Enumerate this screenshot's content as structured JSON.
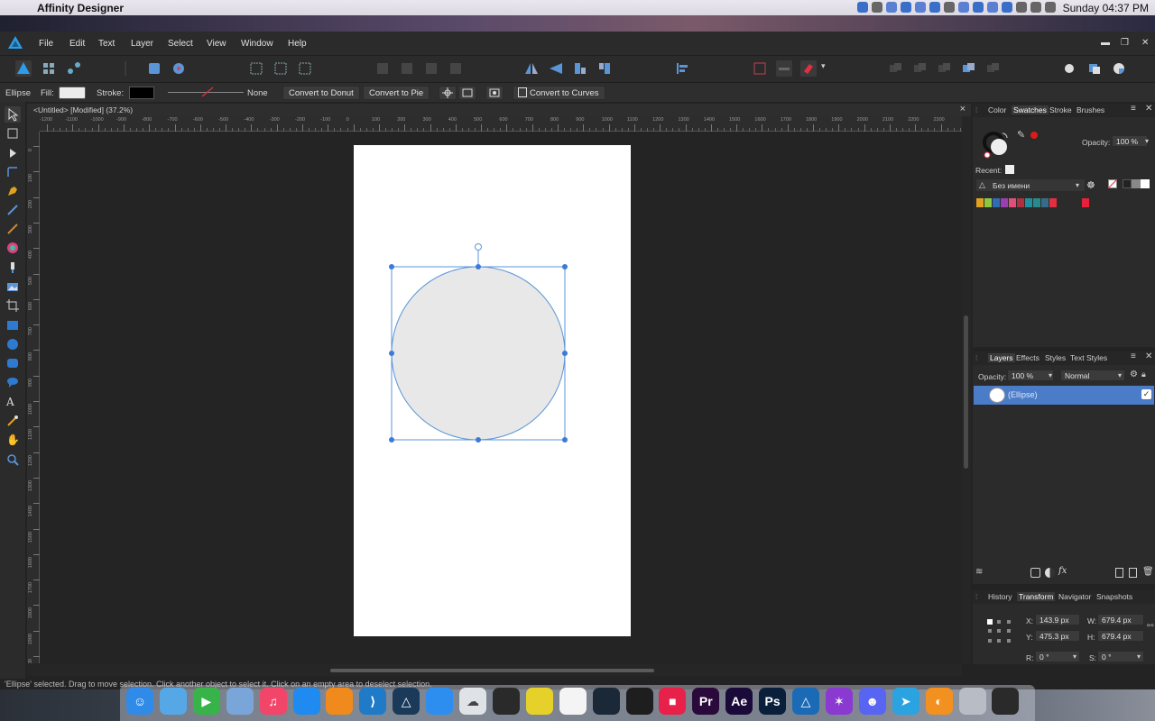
{
  "menubar": {
    "app_name": "Affinity Designer",
    "clock": "Sunday 04:37 PM"
  },
  "app_menu": [
    "File",
    "Edit",
    "Text",
    "Layer",
    "Select",
    "View",
    "Window",
    "Help"
  ],
  "context_bar": {
    "tool_name": "Ellipse",
    "fill_label": "Fill:",
    "stroke_label": "Stroke:",
    "stroke_none": "None",
    "convert_donut": "Convert to Donut",
    "convert_pie": "Convert to Pie",
    "convert_curves": "Convert to Curves"
  },
  "document": {
    "tab_title": "<Untitled> [Modified] (37.2%)",
    "close": "×"
  },
  "ruler_h_labels": [
    "-1200",
    "-1100",
    "-1000",
    "-900",
    "-800",
    "-700",
    "-600",
    "-500",
    "-400",
    "-300",
    "-200",
    "-100",
    "0",
    "100",
    "200",
    "300",
    "400",
    "500",
    "600",
    "700",
    "800",
    "900",
    "1000",
    "1100",
    "1200",
    "1300",
    "1400",
    "1500",
    "1600",
    "1700",
    "1800",
    "1900",
    "2000",
    "2100",
    "2200",
    "2300"
  ],
  "ruler_v_labels": [
    "0",
    "100",
    "200",
    "300",
    "400",
    "500",
    "600",
    "700",
    "800",
    "900",
    "1000",
    "1100",
    "1200",
    "1300",
    "1400",
    "1500",
    "1600",
    "1700",
    "1800",
    "1900",
    "2000"
  ],
  "status_text": "'Ellipse' selected. Drag to move selection. Click another object to select it. Click on an empty area to deselect selection.",
  "color_panel": {
    "tabs": [
      "Color",
      "Swatches",
      "Stroke",
      "Brushes"
    ],
    "active_tab": "Swatches",
    "opacity_label": "Opacity:",
    "opacity_value": "100 %",
    "recent_label": "Recent:",
    "palette_name": "Без имени",
    "swatch_colors": [
      "#e0a020",
      "#8dc63f",
      "#2f6db5",
      "#9a3fb0",
      "#e0507a",
      "#b03040",
      "#1e90a0",
      "#2a8a8a",
      "#3a6a8a",
      "#e03040",
      "#2b2b2b",
      "#2b2b2b",
      "#2b2b2b",
      "#e8203a"
    ]
  },
  "layers_panel": {
    "tabs": [
      "Layers",
      "Effects",
      "Styles",
      "Text Styles"
    ],
    "active_tab": "Layers",
    "opacity_label": "Opacity:",
    "opacity_value": "100 %",
    "blend_mode": "Normal",
    "layer_name": "(Ellipse)",
    "fx_label": "fx"
  },
  "transform_panel": {
    "tabs": [
      "History",
      "Transform",
      "Navigator",
      "Snapshots"
    ],
    "active_tab": "Transform",
    "x_label": "X:",
    "x_value": "143.9 px",
    "y_label": "Y:",
    "y_value": "475.3 px",
    "w_label": "W:",
    "w_value": "679.4 px",
    "h_label": "H:",
    "h_value": "679.4 px",
    "r_label": "R:",
    "r_value": "0 °",
    "s_label": "S:",
    "s_value": "0 °"
  },
  "dock": [
    {
      "name": "Finder",
      "color": "#2f8ae8",
      "glyph": "☺"
    },
    {
      "name": "Files",
      "color": "#56a7e6",
      "glyph": ""
    },
    {
      "name": "FaceTime",
      "color": "#38b34a",
      "glyph": "▶"
    },
    {
      "name": "Preview",
      "color": "#7aa5d8",
      "glyph": ""
    },
    {
      "name": "Music",
      "color": "#f2456a",
      "glyph": "♫"
    },
    {
      "name": "App Store",
      "color": "#1f8af0",
      "glyph": ""
    },
    {
      "name": "Editor",
      "color": "#f08a1c",
      "glyph": ""
    },
    {
      "name": "VS Code",
      "color": "#1f7ac8",
      "glyph": "⟩"
    },
    {
      "name": "Affinity Designer",
      "color": "#1b3a5a",
      "glyph": "△"
    },
    {
      "name": "Safari",
      "color": "#2d8ef0",
      "glyph": ""
    },
    {
      "name": "Cloud",
      "color": "#dfe3e8",
      "glyph": "☁"
    },
    {
      "name": "DaVinci Resolve",
      "color": "#2a2a2a",
      "glyph": ""
    },
    {
      "name": "Nodes",
      "color": "#e6d12a",
      "glyph": ""
    },
    {
      "name": "Photos",
      "color": "#f4f4f4",
      "glyph": ""
    },
    {
      "name": "Steam",
      "color": "#1b2838",
      "glyph": ""
    },
    {
      "name": "Figma",
      "color": "#1e1e1e",
      "glyph": ""
    },
    {
      "name": "Red App",
      "color": "#e8214a",
      "glyph": "■"
    },
    {
      "name": "Premiere Pro",
      "color": "#2a0a3a",
      "glyph": "Pr"
    },
    {
      "name": "After Effects",
      "color": "#1a0a3a",
      "glyph": "Ae"
    },
    {
      "name": "Photoshop",
      "color": "#0a1f3a",
      "glyph": "Ps"
    },
    {
      "name": "Affinity Designer 2",
      "color": "#1b6ab5",
      "glyph": "△"
    },
    {
      "name": "Affinity Photo",
      "color": "#8a3ad0",
      "glyph": "✶"
    },
    {
      "name": "Discord",
      "color": "#5865f2",
      "glyph": "☻"
    },
    {
      "name": "Telegram",
      "color": "#2aa3e0",
      "glyph": "➤"
    },
    {
      "name": "Color Picker",
      "color": "#f29020",
      "glyph": "◐"
    },
    {
      "name": "Trash",
      "color": "#b8bcc4",
      "glyph": ""
    },
    {
      "name": "Screen",
      "color": "#2a2a2a",
      "glyph": ""
    }
  ]
}
